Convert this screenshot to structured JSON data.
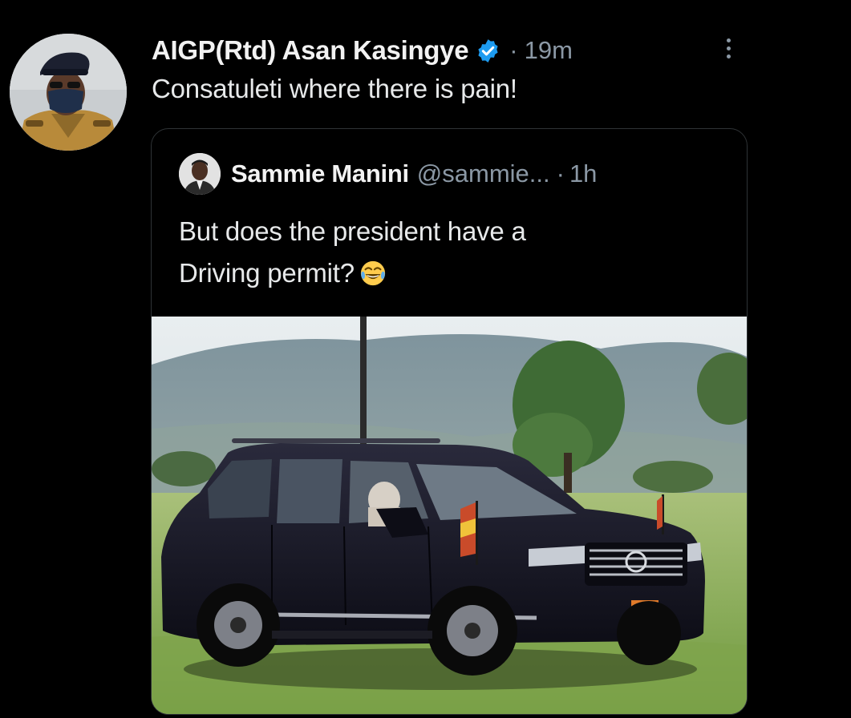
{
  "tweet": {
    "display_name": "AIGP(Rtd) Asan Kasingye",
    "separator": "·",
    "time": "19m",
    "text": "Consatuleti where there is pain!",
    "verified_color": "#1d9bf0"
  },
  "quoted_tweet": {
    "display_name": "Sammie Manini",
    "handle": "@sammie...",
    "separator": "·",
    "time": "1h",
    "text_line1": "But does the president have a",
    "text_line2": "Driving permit?",
    "emoji": "face-with-tears-of-joy"
  },
  "colors": {
    "background": "#000000",
    "text_primary": "#e7e9ea",
    "text_secondary": "#8b98a5",
    "border": "#2f3336"
  },
  "icons": {
    "more": "more-vertical-icon",
    "verified": "verified-badge-icon"
  }
}
